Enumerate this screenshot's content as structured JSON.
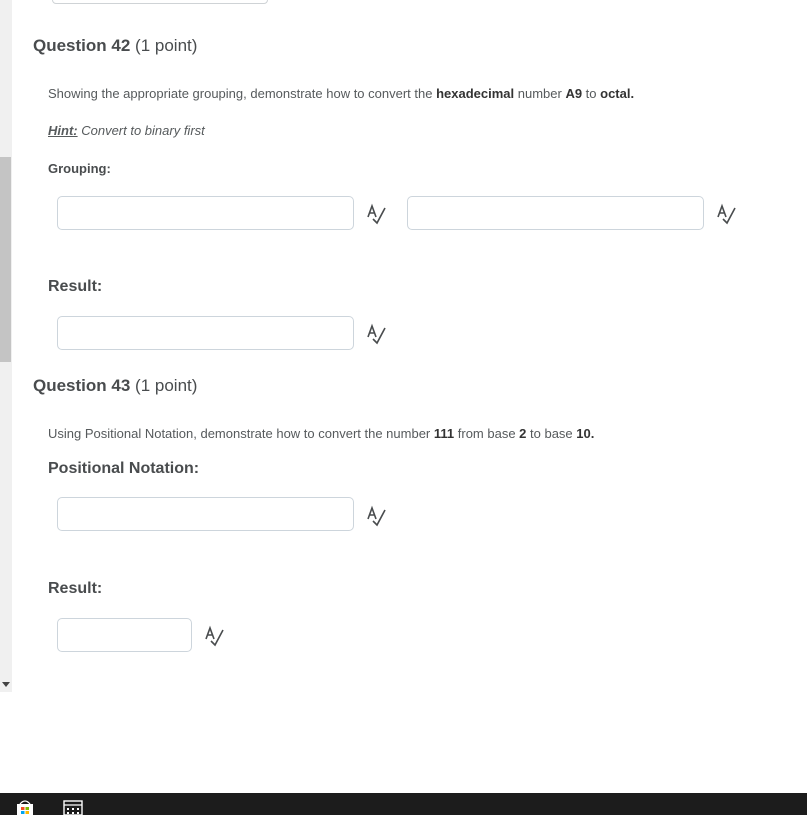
{
  "q42": {
    "heading_title": "Question 42",
    "heading_points": "(1 point)",
    "prompt_start": "Showing the appropriate grouping, demonstrate how to convert the ",
    "prompt_bold1": "hexadecimal",
    "prompt_mid1": " number ",
    "prompt_bold2": "A9",
    "prompt_mid2": " to ",
    "prompt_bold3": "octal.",
    "hint_label": "Hint:",
    "hint_text": " Convert to binary first",
    "grouping_label": "Grouping:",
    "result_label": "Result:",
    "grouping_1_value": "",
    "grouping_2_value": "",
    "result_value": ""
  },
  "q43": {
    "heading_title": "Question 43",
    "heading_points": "(1 point)",
    "prompt_start": "Using Positional Notation, demonstrate how to convert the number ",
    "prompt_bold1": "111",
    "prompt_mid1": " from base ",
    "prompt_bold2": "2",
    "prompt_mid2": " to base ",
    "prompt_bold3": "10.",
    "notation_label": "Positional Notation:",
    "result_label": "Result:",
    "notation_value": "",
    "result_value": ""
  },
  "icons": {
    "spellcheck": "spellcheck-icon",
    "taskbar_store": "store-icon",
    "taskbar_calculator": "calculator-icon"
  }
}
